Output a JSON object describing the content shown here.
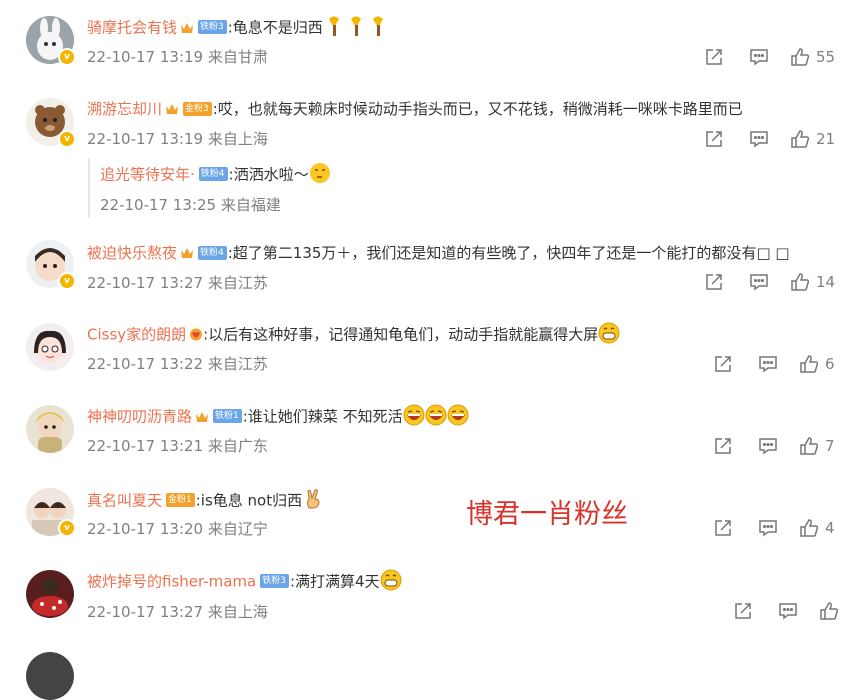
{
  "comments": [
    {
      "username": "骑摩托会有钱",
      "badge": "铁粉3",
      "badge_type": "iron",
      "text": ":龟息不是归西",
      "emojis": [
        "torch-emoji",
        "torch-emoji",
        "torch-emoji"
      ],
      "time": "22-10-17 13:19",
      "location": "来自甘肃",
      "likes": "55"
    },
    {
      "username": "溯游忘却川",
      "badge": "金粉3",
      "badge_type": "gold",
      "text": ":哎，也就每天赖床时候动动手指头而已，又不花钱，稍微消耗一咪咪卡路里而已",
      "emojis": [],
      "time": "22-10-17 13:19",
      "location": "来自上海",
      "likes": "21"
    },
    {
      "username": "被迫快乐熬夜",
      "badge": "铁粉4",
      "badge_type": "iron",
      "text": ":超了第二135万＋，我们还是知道的有些晚了，快四年了还是一个能打的都没有□ □",
      "emojis": [],
      "time": "22-10-17 13:27",
      "location": "来自江苏",
      "likes": "14"
    },
    {
      "username": "Cissy家的朗朗",
      "badge": "",
      "badge_type": "heart",
      "text": ":以后有这种好事，记得通知龟龟们，动动手指就能赢得大屏",
      "emojis": [
        "grin-emoji"
      ],
      "time": "22-10-17 13:22",
      "location": "来自江苏",
      "likes": "6"
    },
    {
      "username": "神神叨叨沥青路",
      "badge": "铁粉1",
      "badge_type": "iron",
      "text": ":谁让她们辣菜 不知死活",
      "emojis": [
        "laugh-emoji",
        "laugh-emoji",
        "laugh-emoji"
      ],
      "time": "22-10-17 13:21",
      "location": "来自广东",
      "likes": "7"
    },
    {
      "username": "真名叫夏天",
      "badge": "金粉1",
      "badge_type": "gold",
      "text": ":is龟息 not归西",
      "emojis": [
        "victory-hand-emoji"
      ],
      "time": "22-10-17 13:20",
      "location": "来自辽宁",
      "likes": "4"
    },
    {
      "username": "被炸掉号的fisher-mama",
      "badge": "铁粉3",
      "badge_type": "iron",
      "text": ":满打满算4天",
      "emojis": [
        "grin-emoji"
      ],
      "time": "22-10-17 13:27",
      "location": "来自上海",
      "likes": ""
    },
    {
      "username": "",
      "badge": "",
      "badge_type": "iron",
      "text": "",
      "emojis": [],
      "time": "",
      "location": "",
      "likes": ""
    }
  ],
  "reply": {
    "username": "追光等待安年·",
    "badge": "铁粉4",
    "text": ":洒洒水啦～",
    "emojis": [
      "think-emoji"
    ],
    "time": "22-10-17 13:25",
    "location": "来自福建"
  },
  "watermark": "博君一肖粉丝",
  "colors": {
    "username": "#eb7350",
    "meta": "#808080",
    "iron_badge": "#6aa5e8",
    "gold_badge": "#f3a12a",
    "watermark": "#d9322a"
  }
}
